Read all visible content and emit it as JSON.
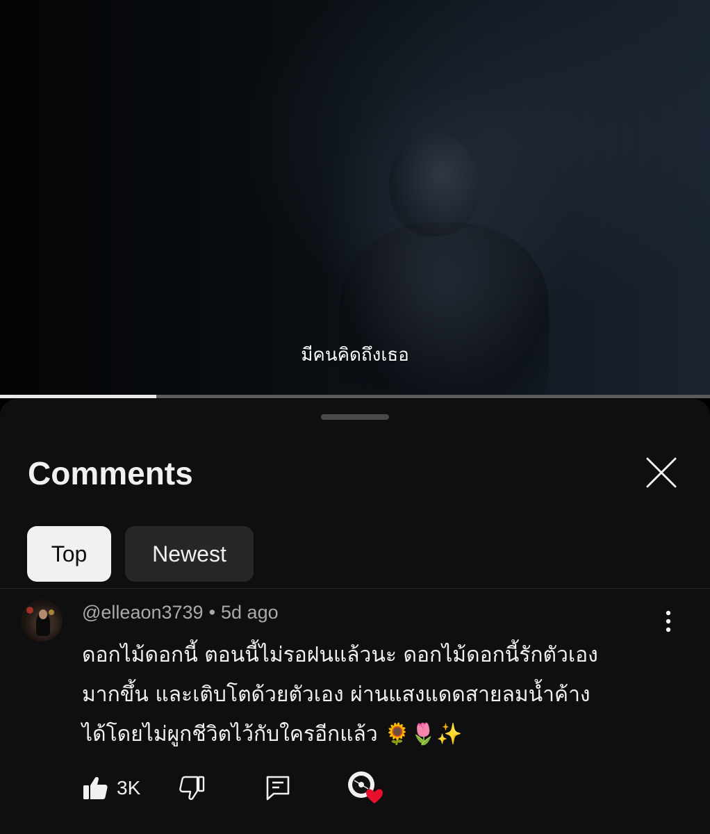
{
  "video": {
    "subtitle": "มีคนคิดถึงเธอ",
    "progress_fraction": 0.22
  },
  "comments_panel": {
    "title": "Comments",
    "close_icon": "close-icon",
    "filters": [
      {
        "label": "Top",
        "selected": true
      },
      {
        "label": "Newest",
        "selected": false
      }
    ]
  },
  "comment": {
    "author": "@elleaon3739",
    "separator": "•",
    "time": "5d ago",
    "lines": [
      "ดอกไม้ดอกนี้ ตอนนี้ไม่รอฝนแล้วนะ ดอกไม้ดอกนี้รักตัวเอง",
      "มากขึ้น และเติบโตด้วยตัวเอง ผ่านแสงแดดสายลมน้ำค้าง",
      "ได้โดยไม่ผูกชีวิตไว้กับใครอีกแล้ว   🌻🌷✨"
    ],
    "like_count": "3K",
    "icons": [
      "like-icon",
      "dislike-icon",
      "reply-icon",
      "creator-heart-icon",
      "more-options-icon"
    ]
  },
  "colors": {
    "sheet_bg": "#0f0f0f",
    "chip_selected_bg": "#f1f1f1",
    "chip_bg": "#272727",
    "secondary_text": "#aaaaaa",
    "heart": "#e8112d"
  }
}
